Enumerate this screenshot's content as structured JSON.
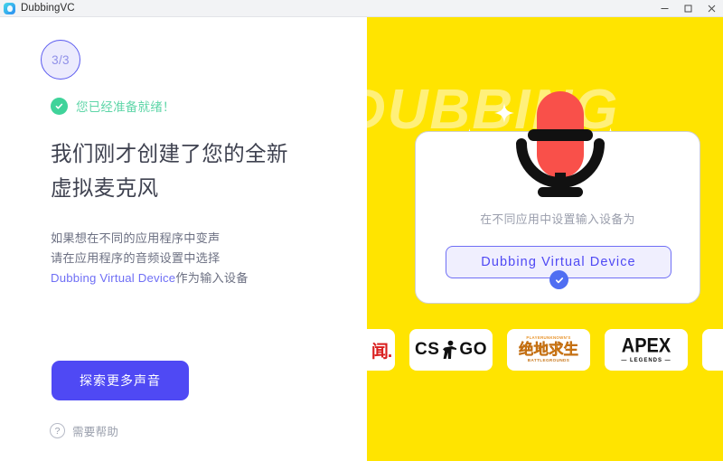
{
  "window": {
    "title": "DubbingVC",
    "app_icon": "dubbing-app-icon",
    "controls": {
      "minimize": "minimize-icon",
      "maximize": "maximize-icon",
      "close": "close-icon"
    }
  },
  "left": {
    "step_indicator": "3/3",
    "ready_status": "您已经准备就绪！",
    "ready_icon": "check-circle-icon",
    "headline_line1": "我们刚才创建了您的全新",
    "headline_line2": "虚拟麦克风",
    "body_line1": "如果想在不同的应用程序中变声",
    "body_line2": "请在应用程序的音频设置中选择",
    "body_line3_link": "Dubbing Virtual Device",
    "body_line3_rest": "作为输入设备",
    "cta_label": "探索更多声音",
    "help_icon": "question-mark-icon",
    "help_label": "需要帮助"
  },
  "right": {
    "watermark": "DUBBING",
    "mic_icon": "microphone-icon",
    "sparkle_icon": "sparkle-icon",
    "card": {
      "caption": "在不同应用中设置输入设备为",
      "device_name": "Dubbing  Virtual  Device",
      "selected_icon": "check-circle-filled-icon"
    },
    "logos": [
      {
        "name": "partial-cn-game-logo",
        "text": "闻."
      },
      {
        "name": "csgo-logo",
        "text_left": "CS",
        "text_right": "GO",
        "icon": "csgo-soldier-icon"
      },
      {
        "name": "pubg-cn-logo",
        "top": "PLAYERUNKNOWN'S",
        "mid": "绝地求生",
        "bottom": "BATTLEGROUNDS"
      },
      {
        "name": "apex-legends-logo",
        "top": "APEX",
        "bottom": "— LEGENDS —"
      },
      {
        "name": "partial-right-logo",
        "text": ""
      }
    ]
  },
  "colors": {
    "accent_blue": "#4f49f4",
    "panel_yellow": "#ffe400",
    "watermark_yellow": "#fff07a",
    "success_green": "#3fd39a",
    "mic_red": "#f9504a",
    "text_dark": "#3f4250",
    "text_muted": "#6d7183"
  }
}
